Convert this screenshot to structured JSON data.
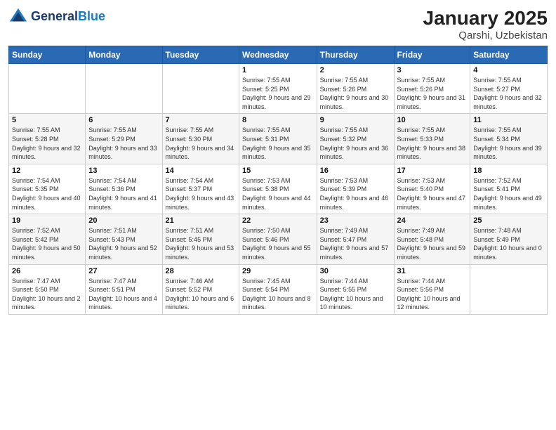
{
  "header": {
    "logo_general": "General",
    "logo_blue": "Blue",
    "title": "January 2025",
    "subtitle": "Qarshi, Uzbekistan"
  },
  "weekdays": [
    "Sunday",
    "Monday",
    "Tuesday",
    "Wednesday",
    "Thursday",
    "Friday",
    "Saturday"
  ],
  "weeks": [
    [
      {
        "day": "",
        "sunrise": "",
        "sunset": "",
        "daylight": ""
      },
      {
        "day": "",
        "sunrise": "",
        "sunset": "",
        "daylight": ""
      },
      {
        "day": "",
        "sunrise": "",
        "sunset": "",
        "daylight": ""
      },
      {
        "day": "1",
        "sunrise": "Sunrise: 7:55 AM",
        "sunset": "Sunset: 5:25 PM",
        "daylight": "Daylight: 9 hours and 29 minutes."
      },
      {
        "day": "2",
        "sunrise": "Sunrise: 7:55 AM",
        "sunset": "Sunset: 5:26 PM",
        "daylight": "Daylight: 9 hours and 30 minutes."
      },
      {
        "day": "3",
        "sunrise": "Sunrise: 7:55 AM",
        "sunset": "Sunset: 5:26 PM",
        "daylight": "Daylight: 9 hours and 31 minutes."
      },
      {
        "day": "4",
        "sunrise": "Sunrise: 7:55 AM",
        "sunset": "Sunset: 5:27 PM",
        "daylight": "Daylight: 9 hours and 32 minutes."
      }
    ],
    [
      {
        "day": "5",
        "sunrise": "Sunrise: 7:55 AM",
        "sunset": "Sunset: 5:28 PM",
        "daylight": "Daylight: 9 hours and 32 minutes."
      },
      {
        "day": "6",
        "sunrise": "Sunrise: 7:55 AM",
        "sunset": "Sunset: 5:29 PM",
        "daylight": "Daylight: 9 hours and 33 minutes."
      },
      {
        "day": "7",
        "sunrise": "Sunrise: 7:55 AM",
        "sunset": "Sunset: 5:30 PM",
        "daylight": "Daylight: 9 hours and 34 minutes."
      },
      {
        "day": "8",
        "sunrise": "Sunrise: 7:55 AM",
        "sunset": "Sunset: 5:31 PM",
        "daylight": "Daylight: 9 hours and 35 minutes."
      },
      {
        "day": "9",
        "sunrise": "Sunrise: 7:55 AM",
        "sunset": "Sunset: 5:32 PM",
        "daylight": "Daylight: 9 hours and 36 minutes."
      },
      {
        "day": "10",
        "sunrise": "Sunrise: 7:55 AM",
        "sunset": "Sunset: 5:33 PM",
        "daylight": "Daylight: 9 hours and 38 minutes."
      },
      {
        "day": "11",
        "sunrise": "Sunrise: 7:55 AM",
        "sunset": "Sunset: 5:34 PM",
        "daylight": "Daylight: 9 hours and 39 minutes."
      }
    ],
    [
      {
        "day": "12",
        "sunrise": "Sunrise: 7:54 AM",
        "sunset": "Sunset: 5:35 PM",
        "daylight": "Daylight: 9 hours and 40 minutes."
      },
      {
        "day": "13",
        "sunrise": "Sunrise: 7:54 AM",
        "sunset": "Sunset: 5:36 PM",
        "daylight": "Daylight: 9 hours and 41 minutes."
      },
      {
        "day": "14",
        "sunrise": "Sunrise: 7:54 AM",
        "sunset": "Sunset: 5:37 PM",
        "daylight": "Daylight: 9 hours and 43 minutes."
      },
      {
        "day": "15",
        "sunrise": "Sunrise: 7:53 AM",
        "sunset": "Sunset: 5:38 PM",
        "daylight": "Daylight: 9 hours and 44 minutes."
      },
      {
        "day": "16",
        "sunrise": "Sunrise: 7:53 AM",
        "sunset": "Sunset: 5:39 PM",
        "daylight": "Daylight: 9 hours and 46 minutes."
      },
      {
        "day": "17",
        "sunrise": "Sunrise: 7:53 AM",
        "sunset": "Sunset: 5:40 PM",
        "daylight": "Daylight: 9 hours and 47 minutes."
      },
      {
        "day": "18",
        "sunrise": "Sunrise: 7:52 AM",
        "sunset": "Sunset: 5:41 PM",
        "daylight": "Daylight: 9 hours and 49 minutes."
      }
    ],
    [
      {
        "day": "19",
        "sunrise": "Sunrise: 7:52 AM",
        "sunset": "Sunset: 5:42 PM",
        "daylight": "Daylight: 9 hours and 50 minutes."
      },
      {
        "day": "20",
        "sunrise": "Sunrise: 7:51 AM",
        "sunset": "Sunset: 5:43 PM",
        "daylight": "Daylight: 9 hours and 52 minutes."
      },
      {
        "day": "21",
        "sunrise": "Sunrise: 7:51 AM",
        "sunset": "Sunset: 5:45 PM",
        "daylight": "Daylight: 9 hours and 53 minutes."
      },
      {
        "day": "22",
        "sunrise": "Sunrise: 7:50 AM",
        "sunset": "Sunset: 5:46 PM",
        "daylight": "Daylight: 9 hours and 55 minutes."
      },
      {
        "day": "23",
        "sunrise": "Sunrise: 7:49 AM",
        "sunset": "Sunset: 5:47 PM",
        "daylight": "Daylight: 9 hours and 57 minutes."
      },
      {
        "day": "24",
        "sunrise": "Sunrise: 7:49 AM",
        "sunset": "Sunset: 5:48 PM",
        "daylight": "Daylight: 9 hours and 59 minutes."
      },
      {
        "day": "25",
        "sunrise": "Sunrise: 7:48 AM",
        "sunset": "Sunset: 5:49 PM",
        "daylight": "Daylight: 10 hours and 0 minutes."
      }
    ],
    [
      {
        "day": "26",
        "sunrise": "Sunrise: 7:47 AM",
        "sunset": "Sunset: 5:50 PM",
        "daylight": "Daylight: 10 hours and 2 minutes."
      },
      {
        "day": "27",
        "sunrise": "Sunrise: 7:47 AM",
        "sunset": "Sunset: 5:51 PM",
        "daylight": "Daylight: 10 hours and 4 minutes."
      },
      {
        "day": "28",
        "sunrise": "Sunrise: 7:46 AM",
        "sunset": "Sunset: 5:52 PM",
        "daylight": "Daylight: 10 hours and 6 minutes."
      },
      {
        "day": "29",
        "sunrise": "Sunrise: 7:45 AM",
        "sunset": "Sunset: 5:54 PM",
        "daylight": "Daylight: 10 hours and 8 minutes."
      },
      {
        "day": "30",
        "sunrise": "Sunrise: 7:44 AM",
        "sunset": "Sunset: 5:55 PM",
        "daylight": "Daylight: 10 hours and 10 minutes."
      },
      {
        "day": "31",
        "sunrise": "Sunrise: 7:44 AM",
        "sunset": "Sunset: 5:56 PM",
        "daylight": "Daylight: 10 hours and 12 minutes."
      },
      {
        "day": "",
        "sunrise": "",
        "sunset": "",
        "daylight": ""
      }
    ]
  ]
}
